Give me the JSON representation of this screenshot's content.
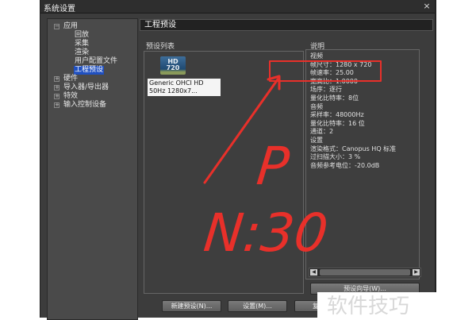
{
  "window": {
    "title": "系统设置",
    "close_icon": "×"
  },
  "tree": [
    {
      "label": "应用",
      "toggle": "−"
    },
    {
      "label": "回放"
    },
    {
      "label": "采集"
    },
    {
      "label": "渲染"
    },
    {
      "label": "用户配置文件"
    },
    {
      "label": "工程预设",
      "selected": true
    },
    {
      "label": "硬件",
      "toggle": "+"
    },
    {
      "label": "导入器/导出器",
      "toggle": "+"
    },
    {
      "label": "特效",
      "toggle": "+"
    },
    {
      "label": "输入控制设备",
      "toggle": "+"
    }
  ],
  "header": "工程预设",
  "preset_list": {
    "label": "预设列表",
    "item": {
      "icon_line1": "HD",
      "icon_line2": "720",
      "line1": "Generic OHCI HD",
      "line2": "50Hz  1280x7..."
    }
  },
  "description": {
    "label": "说明",
    "lines": [
      "视频",
      "帧尺寸：1280 x 720",
      "帧速率：25.00",
      "宽高比：1.0000",
      "场序：逐行",
      "量化比特率：8位",
      "音频",
      "采样率：48000Hz",
      "量化比特率：16 位",
      "通道：2",
      "设置",
      "渲染格式：Canopus HQ 标准",
      "过扫描大小：3 %",
      "音频参考电位：-20.0dB"
    ]
  },
  "buttons": {
    "wizard": "预设向导(W)...",
    "new": "新建预设(N)...",
    "settings": "设置(M)...",
    "third": "复"
  },
  "annotation": {
    "text": "P N:30",
    "color": "#e8302a"
  },
  "watermark": "软件技巧"
}
